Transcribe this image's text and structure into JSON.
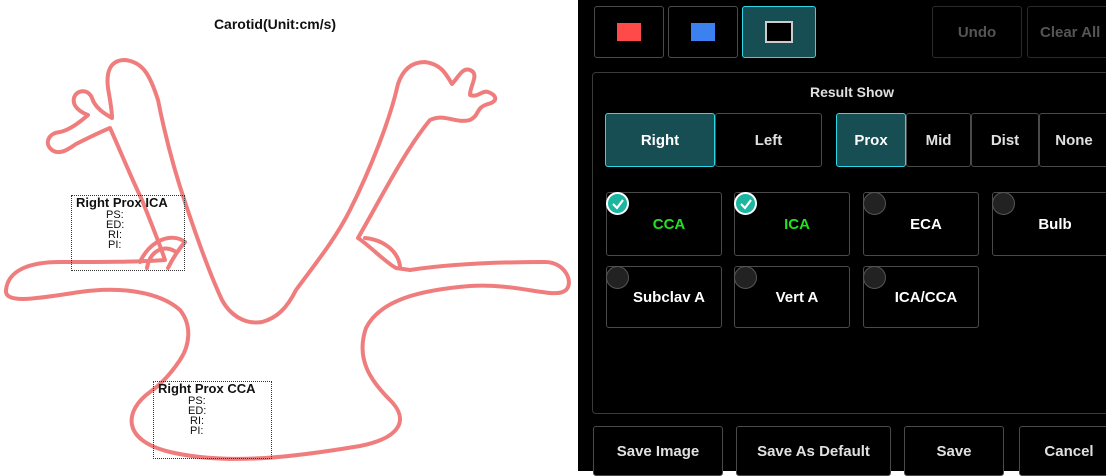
{
  "diagram": {
    "title": "Carotid(Unit:cm/s)",
    "vessel_color": "#f07d7d",
    "ica_box": {
      "header": "Right Prox ICA",
      "rows": [
        "PS:",
        "ED:",
        "RI:",
        "PI:"
      ]
    },
    "cca_box": {
      "header": "Right Prox CCA",
      "rows": [
        "PS:",
        "ED:",
        "RI:",
        "PI:"
      ]
    }
  },
  "toolbar": {
    "colors": [
      {
        "name": "red",
        "hex": "#ff4a4a"
      },
      {
        "name": "blue",
        "hex": "#3b82f0"
      },
      {
        "name": "black",
        "hex": "#000000"
      }
    ],
    "selected_color": "black",
    "undo_label": "Undo",
    "clear_all_label": "Clear All"
  },
  "result_show": {
    "title": "Result Show",
    "side": {
      "options": [
        "Right",
        "Left"
      ],
      "selected": "Right"
    },
    "position": {
      "options": [
        "Prox",
        "Mid",
        "Dist",
        "None"
      ],
      "selected": "Prox"
    },
    "vessels": [
      {
        "label": "CCA",
        "checked": true
      },
      {
        "label": "ICA",
        "checked": true
      },
      {
        "label": "ECA",
        "checked": false
      },
      {
        "label": "Bulb",
        "checked": false
      },
      {
        "label": "Subclav A",
        "checked": false
      },
      {
        "label": "Vert A",
        "checked": false
      },
      {
        "label": "ICA/CCA",
        "checked": false
      }
    ]
  },
  "footer": {
    "save_image_label": "Save Image",
    "save_default_label": "Save As Default",
    "save_label": "Save",
    "cancel_label": "Cancel"
  },
  "colors": {
    "accent": "#2dd8e6",
    "active_bg": "#174e54",
    "checked_text": "#22e022"
  }
}
